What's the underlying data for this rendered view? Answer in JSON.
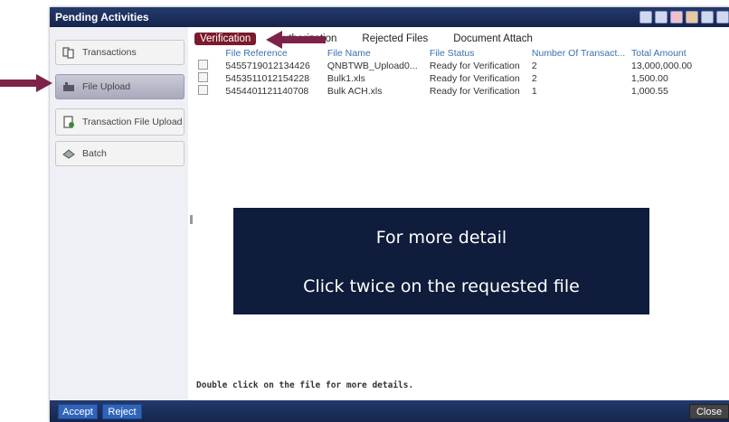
{
  "window": {
    "title": "Pending Activities"
  },
  "sidebar": {
    "items": [
      {
        "label": "Transactions",
        "icon": "transactions-icon"
      },
      {
        "label": "File Upload",
        "icon": "file-upload-icon",
        "active": true
      },
      {
        "label": "Transaction File Upload",
        "icon": "transaction-file-upload-icon"
      },
      {
        "label": "Batch",
        "icon": "batch-icon"
      }
    ]
  },
  "tabs": [
    {
      "label": "Verification",
      "active": true
    },
    {
      "label": "Authorization"
    },
    {
      "label": "Rejected Files"
    },
    {
      "label": "Document Attach"
    }
  ],
  "table": {
    "headers": [
      "File Reference",
      "File Name",
      "File Status",
      "Number Of Transact...",
      "Total Amount"
    ],
    "rows": [
      [
        "5455719012134426",
        "QNBTWB_Upload0...",
        "Ready for Verification",
        "2",
        "13,000,000.00"
      ],
      [
        "5453511012154228",
        "Bulk1.xls",
        "Ready for Verification",
        "2",
        "1,500.00"
      ],
      [
        "5454401121140708",
        "Bulk ACH.xls",
        "Ready for Verification",
        "1",
        "1,000.55"
      ]
    ]
  },
  "footer_note": "Double click on the file for more details.",
  "buttons": {
    "accept": "Accept",
    "reject": "Reject",
    "close": "Close"
  },
  "overlay": {
    "line1": "For more detail",
    "line2": "Click twice on the requested file"
  },
  "colors": {
    "accent": "#7a1a2a",
    "arrow": "#7d2248",
    "header_blue": "#1e3366",
    "overlay_bg": "#0f1c3b",
    "column_header": "#3a6fb0"
  }
}
